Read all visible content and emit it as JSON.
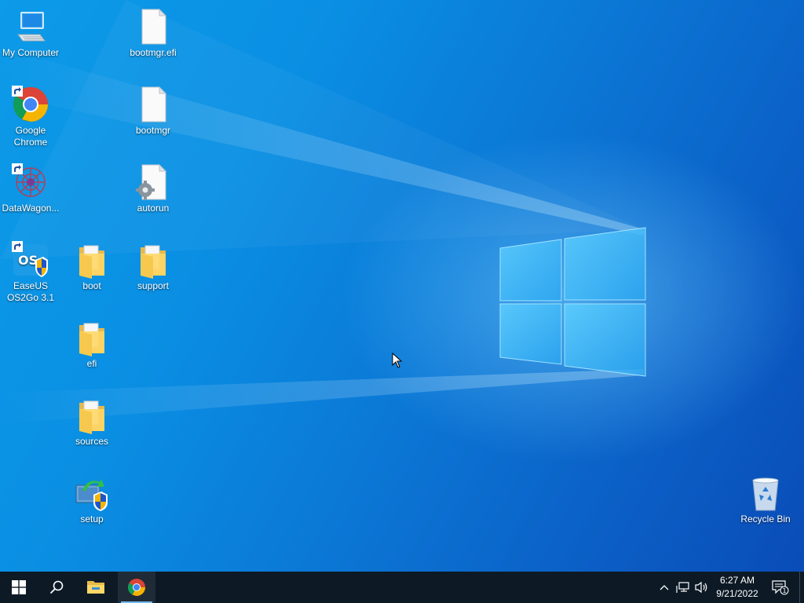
{
  "desktop": {
    "icons": [
      {
        "label": "My Computer",
        "icon": "computer-icon"
      },
      {
        "label": "Google Chrome",
        "icon": "chrome-icon"
      },
      {
        "label": "DataWagon...",
        "icon": "datawagon-icon"
      },
      {
        "label": "EaseUS OS2Go 3.1",
        "icon": "easeus-os2go-icon"
      },
      {
        "label": "bootmgr.efi",
        "icon": "file-icon"
      },
      {
        "label": "bootmgr",
        "icon": "file-icon"
      },
      {
        "label": "autorun",
        "icon": "settings-file-icon"
      },
      {
        "label": "boot",
        "icon": "folder-icon"
      },
      {
        "label": "support",
        "icon": "folder-icon"
      },
      {
        "label": "efi",
        "icon": "folder-icon"
      },
      {
        "label": "sources",
        "icon": "folder-icon"
      },
      {
        "label": "setup",
        "icon": "setup-icon"
      },
      {
        "label": "Recycle Bin",
        "icon": "recycle-bin-icon"
      }
    ]
  },
  "taskbar": {
    "buttons": [
      {
        "name": "start",
        "icon": "windows-logo-icon"
      },
      {
        "name": "search",
        "icon": "search-icon"
      },
      {
        "name": "file-explorer",
        "icon": "folder-icon"
      },
      {
        "name": "google-chrome",
        "icon": "chrome-icon",
        "active": true
      }
    ],
    "tray": {
      "icons": [
        "chevron-up-icon",
        "network-icon",
        "volume-icon"
      ],
      "clock": {
        "time": "6:27 AM",
        "date": "9/21/2022"
      },
      "notifications": {
        "icon": "action-center-icon",
        "count": "1"
      }
    }
  },
  "colors": {
    "taskbar_bg": "#0d1a26",
    "accent": "#76b9ed",
    "wallpaper_blue": "#0a8fe3"
  }
}
